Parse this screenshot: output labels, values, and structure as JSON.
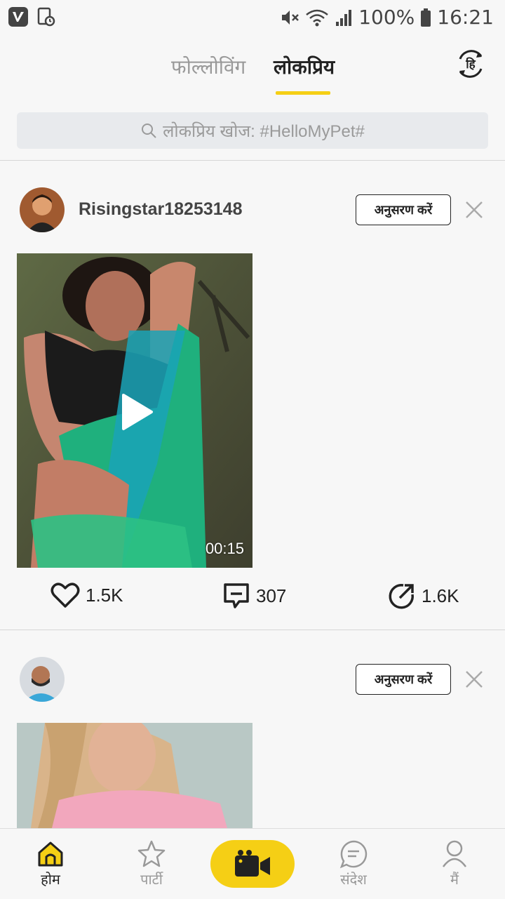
{
  "status_bar": {
    "battery": "100%",
    "time": "16:21"
  },
  "header": {
    "tabs": [
      {
        "label": "फोल्लोविंग",
        "active": false
      },
      {
        "label": "लोकप्रिय",
        "active": true
      }
    ],
    "accent_color": "#f5cf15",
    "language_icon": "hindi-language-icon"
  },
  "search": {
    "placeholder": "लोकप्रिय खोज: #HelloMyPet#"
  },
  "posts": [
    {
      "username": "Risingstar18253148",
      "follow_label": "अनुसरण करें",
      "duration": "00:15",
      "likes": "1.5K",
      "comments": "307",
      "shares": "1.6K"
    },
    {
      "username": "",
      "follow_label": "अनुसरण करें"
    }
  ],
  "bottom_nav": {
    "items": [
      {
        "label": "होम",
        "icon": "home-icon",
        "active": true
      },
      {
        "label": "पार्टी",
        "icon": "star-icon",
        "active": false
      },
      {
        "label": "",
        "icon": "video-camera-icon",
        "active": false
      },
      {
        "label": "संदेश",
        "icon": "message-icon",
        "active": false
      },
      {
        "label": "मैं",
        "icon": "profile-icon",
        "active": false
      }
    ]
  }
}
